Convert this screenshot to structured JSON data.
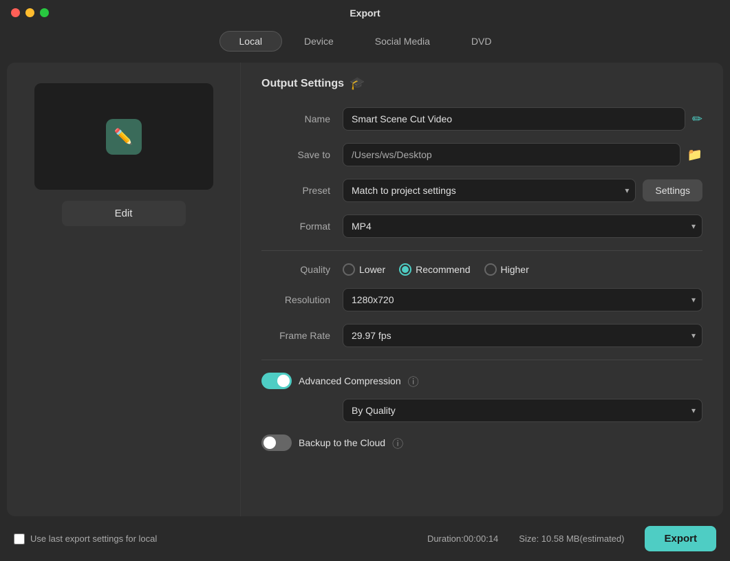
{
  "titlebar": {
    "title": "Export"
  },
  "tabs": [
    {
      "label": "Local",
      "active": true
    },
    {
      "label": "Device",
      "active": false
    },
    {
      "label": "Social Media",
      "active": false
    },
    {
      "label": "DVD",
      "active": false
    }
  ],
  "left_panel": {
    "edit_button": "Edit"
  },
  "output_settings": {
    "section_title": "Output Settings",
    "name_label": "Name",
    "name_value": "Smart Scene Cut Video",
    "save_to_label": "Save to",
    "save_to_value": "/Users/ws/Desktop",
    "preset_label": "Preset",
    "preset_value": "Match to project settings",
    "settings_button": "Settings",
    "format_label": "Format",
    "format_value": "MP4",
    "quality_label": "Quality",
    "quality_options": [
      {
        "label": "Lower",
        "value": "lower"
      },
      {
        "label": "Recommend",
        "value": "recommend",
        "checked": true
      },
      {
        "label": "Higher",
        "value": "higher"
      }
    ],
    "resolution_label": "Resolution",
    "resolution_value": "1280x720",
    "frame_rate_label": "Frame Rate",
    "frame_rate_value": "29.97 fps",
    "advanced_compression_label": "Advanced Compression",
    "advanced_compression_enabled": true,
    "compression_mode_value": "By Quality",
    "backup_cloud_label": "Backup to the Cloud",
    "backup_cloud_enabled": false
  },
  "bottom_bar": {
    "last_export_label": "Use last export settings for local",
    "duration": "Duration:00:00:14",
    "size": "Size: 10.58 MB(estimated)",
    "export_button": "Export"
  },
  "icons": {
    "edit_pencil": "✏️",
    "ai": "✏",
    "folder": "📁",
    "mortar_board": "🎓",
    "question": "?",
    "chevron_down": "▾"
  }
}
